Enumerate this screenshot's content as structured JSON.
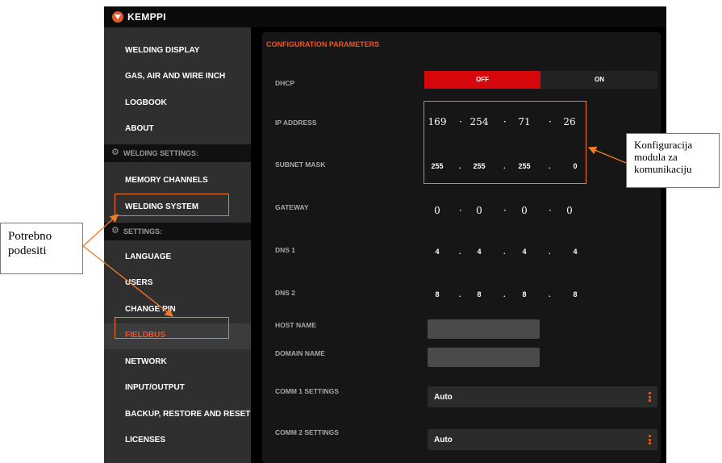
{
  "app": {
    "brand": "KEMPPI"
  },
  "sidebar": {
    "items": [
      {
        "label": "WELDING DISPLAY"
      },
      {
        "label": "GAS, AIR AND WIRE INCH"
      },
      {
        "label": "LOGBOOK"
      },
      {
        "label": "ABOUT"
      },
      {
        "label": "WELDING SETTINGS:"
      },
      {
        "label": "MEMORY CHANNELS"
      },
      {
        "label": "WELDING SYSTEM"
      },
      {
        "label": "SETTINGS:"
      },
      {
        "label": "LANGUAGE"
      },
      {
        "label": "USERS"
      },
      {
        "label": "CHANGE PIN"
      },
      {
        "label": "FIELDBUS"
      },
      {
        "label": "NETWORK"
      },
      {
        "label": "INPUT/OUTPUT"
      },
      {
        "label": "BACKUP, RESTORE AND RESET"
      },
      {
        "label": "LICENSES"
      }
    ],
    "active": "FIELDBUS"
  },
  "config": {
    "title": "CONFIGURATION PARAMETERS",
    "dhcp": {
      "label": "DHCP",
      "off": "OFF",
      "on": "ON",
      "selected": "OFF"
    },
    "ip_address": {
      "label": "IP ADDRESS",
      "octets": [
        "169",
        "254",
        "71",
        "26"
      ]
    },
    "subnet_mask": {
      "label": "SUBNET MASK",
      "octets": [
        "255",
        "255",
        "255",
        "0"
      ]
    },
    "gateway": {
      "label": "GATEWAY",
      "octets": [
        "0",
        "0",
        "0",
        "0"
      ]
    },
    "dns1": {
      "label": "DNS 1",
      "octets": [
        "4",
        "4",
        "4",
        "4"
      ]
    },
    "dns2": {
      "label": "DNS 2",
      "octets": [
        "8",
        "8",
        "8",
        "8"
      ]
    },
    "host_name": {
      "label": "HOST NAME",
      "value": ""
    },
    "domain_name": {
      "label": "DOMAIN NAME",
      "value": ""
    },
    "comm1": {
      "label": "COMM 1 SETTINGS",
      "value": "Auto"
    },
    "comm2": {
      "label": "COMM 2 SETTINGS",
      "value": "Auto"
    }
  },
  "annotations": {
    "left": "Potrebno podesiti",
    "right": "Konfiguracija modula za komunikaciju"
  },
  "colors": {
    "accent": "#e8572a",
    "toggle_active": "#d7080c",
    "annotation": "#f07a2a"
  }
}
